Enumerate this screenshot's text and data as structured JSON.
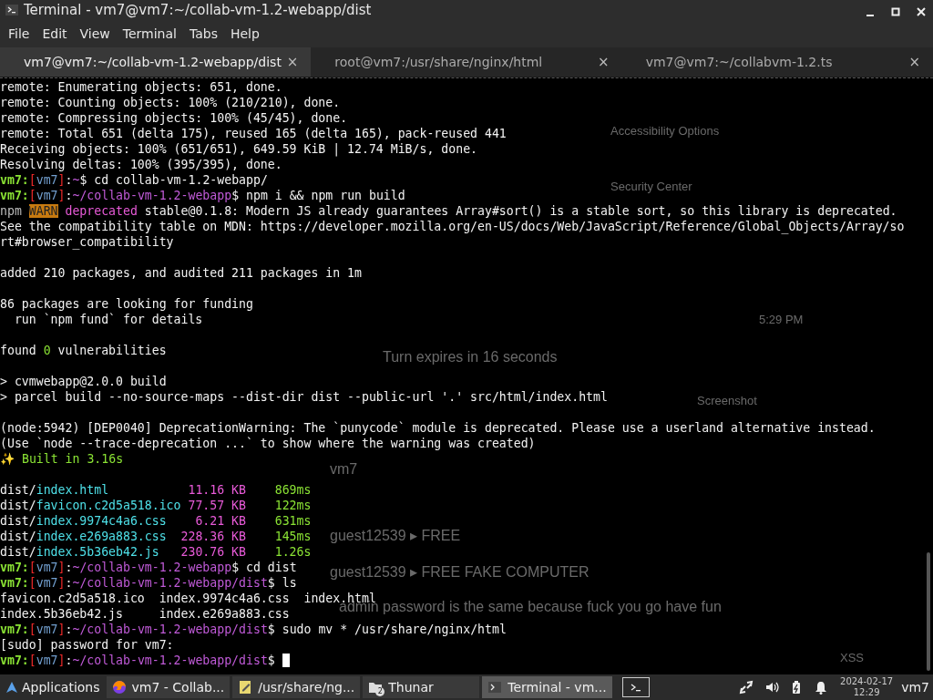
{
  "window": {
    "title": "Terminal - vm7@vm7:~/collab-vm-1.2-webapp/dist"
  },
  "menu": [
    "File",
    "Edit",
    "View",
    "Terminal",
    "Tabs",
    "Help"
  ],
  "tabs": [
    {
      "label": "vm7@vm7:~/collab-vm-1.2-webapp/dist",
      "selected": true,
      "close": "×"
    },
    {
      "label": "root@vm7:/usr/share/nginx/html",
      "selected": false,
      "close": "×"
    },
    {
      "label": "vm7@vm7:~/collabvm-1.2.ts",
      "selected": false,
      "close": "×"
    }
  ],
  "background_window": {
    "texts": [
      "Accessibility Options",
      "Security Center",
      "5:29 PM",
      "Turn expires in 16 seconds",
      "Screenshot",
      "vm7",
      "guest12539 ▸ FREE",
      "guest12539 ▸ FREE FAKE COMPUTER",
      "admin password is the same because fuck you go have fun",
      "XSS"
    ]
  },
  "terminal": {
    "lines": [
      {
        "kind": "text",
        "segments": [
          {
            "kind": "plain",
            "text": "remote: Enumerating objects: 651, done."
          }
        ]
      },
      {
        "kind": "text",
        "segments": [
          {
            "kind": "plain",
            "text": "remote: Counting objects: 100% (210/210), done."
          }
        ]
      },
      {
        "kind": "text",
        "segments": [
          {
            "kind": "plain",
            "text": "remote: Compressing objects: 100% (45/45), done."
          }
        ]
      },
      {
        "kind": "text",
        "segments": [
          {
            "kind": "plain",
            "text": "remote: Total 651 (delta 175), reused 165 (delta 165), pack-reused 441"
          }
        ]
      },
      {
        "kind": "text",
        "segments": [
          {
            "kind": "plain",
            "text": "Receiving objects: 100% (651/651), 649.59 KiB | 12.74 MiB/s, done."
          }
        ]
      },
      {
        "kind": "text",
        "segments": [
          {
            "kind": "plain",
            "text": "Resolving deltas: 100% (395/395), done."
          }
        ]
      },
      {
        "kind": "text",
        "segments": [
          {
            "kind": "user",
            "text": "vm7:"
          },
          {
            "kind": "bracket",
            "text": "["
          },
          {
            "kind": "host",
            "text": "vm7"
          },
          {
            "kind": "bracket",
            "text": "]"
          },
          {
            "kind": "plain",
            "text": ":"
          },
          {
            "kind": "path",
            "text": "~"
          },
          {
            "kind": "plain",
            "text": "$ cd collab-vm-1.2-webapp/"
          }
        ]
      },
      {
        "kind": "text",
        "segments": [
          {
            "kind": "user",
            "text": "vm7:"
          },
          {
            "kind": "bracket",
            "text": "["
          },
          {
            "kind": "host",
            "text": "vm7"
          },
          {
            "kind": "bracket",
            "text": "]"
          },
          {
            "kind": "plain",
            "text": ":"
          },
          {
            "kind": "path",
            "text": "~/collab-vm-1.2-webapp"
          },
          {
            "kind": "plain",
            "text": "$ npm i && npm run build"
          }
        ]
      },
      {
        "kind": "text",
        "segments": [
          {
            "kind": "dim",
            "text": "npm "
          },
          {
            "kind": "warn",
            "text": "WARN"
          },
          {
            "kind": "pink",
            "text": " deprecated"
          },
          {
            "kind": "plain",
            "text": " stable@0.1.8: Modern JS already guarantees Array#sort() is a stable sort, so this library is deprecated."
          }
        ]
      },
      {
        "kind": "text",
        "segments": [
          {
            "kind": "plain",
            "text": "See the compatibility table on MDN: https://developer.mozilla.org/en-US/docs/Web/JavaScript/Reference/Global_Objects/Array/so"
          }
        ]
      },
      {
        "kind": "text",
        "segments": [
          {
            "kind": "plain",
            "text": "rt#browser_compatibility"
          }
        ]
      },
      {
        "kind": "blank"
      },
      {
        "kind": "text",
        "segments": [
          {
            "kind": "plain",
            "text": "added 210 packages, and audited 211 packages in 1m"
          }
        ]
      },
      {
        "kind": "blank"
      },
      {
        "kind": "text",
        "segments": [
          {
            "kind": "plain",
            "text": "86 packages are looking for funding"
          }
        ]
      },
      {
        "kind": "text",
        "segments": [
          {
            "kind": "plain",
            "text": "  run `npm fund` for details"
          }
        ]
      },
      {
        "kind": "blank"
      },
      {
        "kind": "text",
        "segments": [
          {
            "kind": "plain",
            "text": "found "
          },
          {
            "kind": "green",
            "text": "0"
          },
          {
            "kind": "plain",
            "text": " vulnerabilities"
          }
        ]
      },
      {
        "kind": "blank"
      },
      {
        "kind": "text",
        "segments": [
          {
            "kind": "plain",
            "text": "> cvmwebapp@2.0.0 build"
          }
        ]
      },
      {
        "kind": "text",
        "segments": [
          {
            "kind": "plain",
            "text": "> parcel build --no-source-maps --dist-dir dist --public-url '.' src/html/index.html"
          }
        ]
      },
      {
        "kind": "blank"
      },
      {
        "kind": "text",
        "segments": [
          {
            "kind": "plain",
            "text": "(node:5942) [DEP0040] DeprecationWarning: The `punycode` module is deprecated. Please use a userland alternative instead."
          }
        ]
      },
      {
        "kind": "text",
        "segments": [
          {
            "kind": "plain",
            "text": "(Use `node --trace-deprecation ...` to show where the warning was created)"
          }
        ]
      },
      {
        "kind": "text",
        "segments": [
          {
            "kind": "plain",
            "text": "✨ "
          },
          {
            "kind": "green",
            "text": "Built in 3.16s"
          }
        ]
      },
      {
        "kind": "blank"
      },
      {
        "kind": "text",
        "segments": [
          {
            "kind": "plain",
            "text": "dist/"
          },
          {
            "kind": "cyan",
            "text": "index.html"
          },
          {
            "kind": "pink",
            "text": "           11.16 KB"
          },
          {
            "kind": "green",
            "text": "    869ms"
          }
        ]
      },
      {
        "kind": "text",
        "segments": [
          {
            "kind": "plain",
            "text": "dist/"
          },
          {
            "kind": "cyan",
            "text": "favicon.c2d5a518.ico"
          },
          {
            "kind": "pink",
            "text": " 77.57 KB"
          },
          {
            "kind": "green",
            "text": "    122ms"
          }
        ]
      },
      {
        "kind": "text",
        "segments": [
          {
            "kind": "plain",
            "text": "dist/"
          },
          {
            "kind": "cyan",
            "text": "index.9974c4a6.css"
          },
          {
            "kind": "pink",
            "text": "    6.21 KB"
          },
          {
            "kind": "green",
            "text": "    631ms"
          }
        ]
      },
      {
        "kind": "text",
        "segments": [
          {
            "kind": "plain",
            "text": "dist/"
          },
          {
            "kind": "cyan",
            "text": "index.e269a883.css"
          },
          {
            "kind": "pink",
            "text": "  228.36 KB"
          },
          {
            "kind": "green",
            "text": "    145ms"
          }
        ]
      },
      {
        "kind": "text",
        "segments": [
          {
            "kind": "plain",
            "text": "dist/"
          },
          {
            "kind": "cyan",
            "text": "index.5b36eb42.js"
          },
          {
            "kind": "pink",
            "text": "   230.76 KB"
          },
          {
            "kind": "green",
            "text": "    1.26s"
          }
        ]
      },
      {
        "kind": "text",
        "segments": [
          {
            "kind": "user",
            "text": "vm7:"
          },
          {
            "kind": "bracket",
            "text": "["
          },
          {
            "kind": "host",
            "text": "vm7"
          },
          {
            "kind": "bracket",
            "text": "]"
          },
          {
            "kind": "plain",
            "text": ":"
          },
          {
            "kind": "path",
            "text": "~/collab-vm-1.2-webapp"
          },
          {
            "kind": "plain",
            "text": "$ cd dist"
          }
        ]
      },
      {
        "kind": "text",
        "segments": [
          {
            "kind": "user",
            "text": "vm7:"
          },
          {
            "kind": "bracket",
            "text": "["
          },
          {
            "kind": "host",
            "text": "vm7"
          },
          {
            "kind": "bracket",
            "text": "]"
          },
          {
            "kind": "plain",
            "text": ":"
          },
          {
            "kind": "path",
            "text": "~/collab-vm-1.2-webapp/dist"
          },
          {
            "kind": "plain",
            "text": "$ ls"
          }
        ]
      },
      {
        "kind": "text",
        "segments": [
          {
            "kind": "plain",
            "text": "favicon.c2d5a518.ico  index.9974c4a6.css  index.html"
          }
        ]
      },
      {
        "kind": "text",
        "segments": [
          {
            "kind": "plain",
            "text": "index.5b36eb42.js     index.e269a883.css"
          }
        ]
      },
      {
        "kind": "text",
        "segments": [
          {
            "kind": "user",
            "text": "vm7:"
          },
          {
            "kind": "bracket",
            "text": "["
          },
          {
            "kind": "host",
            "text": "vm7"
          },
          {
            "kind": "bracket",
            "text": "]"
          },
          {
            "kind": "plain",
            "text": ":"
          },
          {
            "kind": "path",
            "text": "~/collab-vm-1.2-webapp/dist"
          },
          {
            "kind": "plain",
            "text": "$ sudo mv * /usr/share/nginx/html"
          }
        ]
      },
      {
        "kind": "text",
        "segments": [
          {
            "kind": "plain",
            "text": "[sudo] password for vm7:"
          }
        ]
      },
      {
        "kind": "text",
        "segments": [
          {
            "kind": "user",
            "text": "vm7:"
          },
          {
            "kind": "bracket",
            "text": "["
          },
          {
            "kind": "host",
            "text": "vm7"
          },
          {
            "kind": "bracket",
            "text": "]"
          },
          {
            "kind": "plain",
            "text": ":"
          },
          {
            "kind": "path",
            "text": "~/collab-vm-1.2-webapp/dist"
          },
          {
            "kind": "plain",
            "text": "$"
          }
        ]
      }
    ],
    "cursor": true
  },
  "taskbar": {
    "menu": "Applications",
    "windows": [
      {
        "label": "vm7 - Collab...",
        "kind": "browser",
        "selected": false
      },
      {
        "label": "/usr/share/ng...",
        "kind": "editor",
        "selected": false
      },
      {
        "label": "Thunar",
        "kind": "folder",
        "badge": "2",
        "selected": false
      },
      {
        "label": "Terminal - vm...",
        "kind": "terminal",
        "selected": true
      }
    ],
    "date": "2024-02-17",
    "time": "12:29",
    "user": "vm7"
  }
}
